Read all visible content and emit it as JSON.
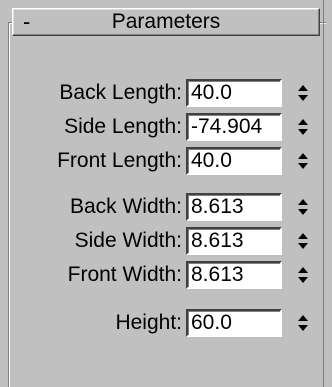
{
  "rollout": {
    "collapse_symbol": "-",
    "title": "Parameters"
  },
  "params": [
    {
      "label": "Back Length:",
      "value": "40.0"
    },
    {
      "label": "Side Length:",
      "value": "-74.904"
    },
    {
      "label": "Front Length:",
      "value": "40.0"
    },
    {
      "label": "Back Width:",
      "value": "8.613"
    },
    {
      "label": "Side Width:",
      "value": "8.613"
    },
    {
      "label": "Front Width:",
      "value": "8.613"
    },
    {
      "label": "Height:",
      "value": "60.0"
    }
  ]
}
